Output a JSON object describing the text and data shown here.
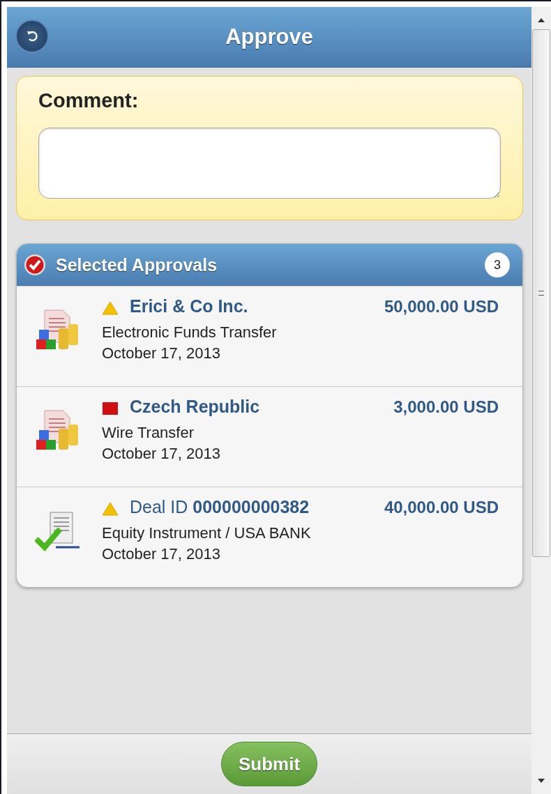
{
  "header": {
    "title": "Approve"
  },
  "comment": {
    "label": "Comment:"
  },
  "approvals": {
    "title": "Selected Approvals",
    "count": "3",
    "items": [
      {
        "kind": "funds",
        "status": {
          "kind": "warning"
        },
        "name": "Erici & Co Inc.",
        "amount": "50,000.00 USD",
        "type": "Electronic Funds Transfer",
        "date": "October 17, 2013"
      },
      {
        "kind": "funds",
        "status": {
          "kind": "error"
        },
        "name": "Czech Republic",
        "amount": "3,000.00 USD",
        "type": "Wire Transfer",
        "date": "October 17, 2013"
      },
      {
        "kind": "deal",
        "status": {
          "kind": "warning"
        },
        "name": "Deal ID **000000000382**",
        "amount": "40,000.00 USD",
        "type": "Equity Instrument / USA BANK",
        "date": "October 17, 2013"
      }
    ]
  },
  "footer": {
    "button": "Submit"
  }
}
